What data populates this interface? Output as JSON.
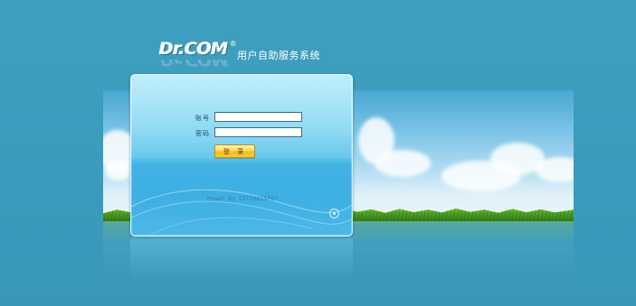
{
  "header": {
    "logo_text": "Dr.COM",
    "logo_registered": "®",
    "system_title": "用户自助服务系统"
  },
  "login_form": {
    "account_label": "账号",
    "account_value": "",
    "password_label": "密码",
    "password_value": "",
    "login_button_label": "登 录"
  },
  "footer": {
    "powered_by": "Power by CITIHUISPOT"
  },
  "colors": {
    "page_background": "#3e9fbf",
    "panel": "#5cc2ea",
    "button": "#ffd95a"
  }
}
